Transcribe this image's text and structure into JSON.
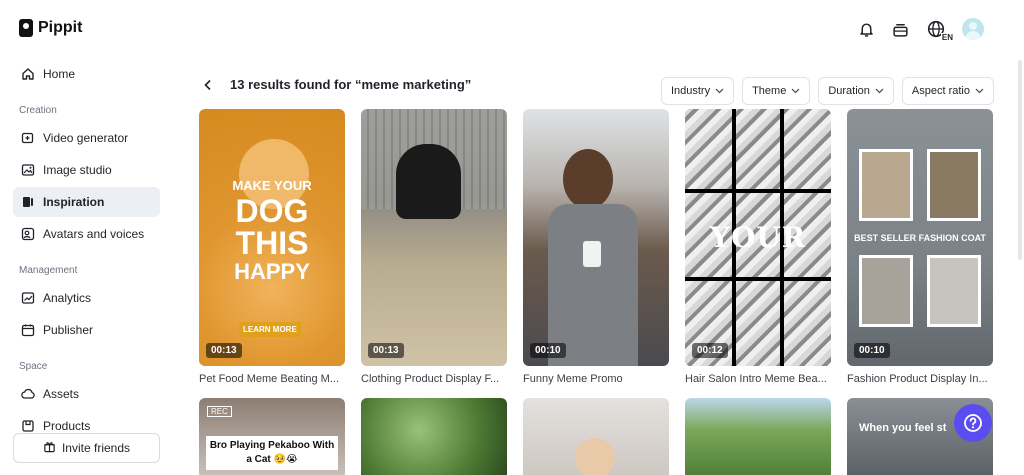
{
  "app": {
    "name": "Pippit"
  },
  "sidebar": {
    "home": "Home",
    "creation_label": "Creation",
    "creation_items": [
      "Video generator",
      "Image studio",
      "Inspiration",
      "Avatars and voices"
    ],
    "management_label": "Management",
    "management_items": [
      "Analytics",
      "Publisher"
    ],
    "space_label": "Space",
    "space_items": [
      "Assets",
      "Products"
    ],
    "invite": "Invite friends"
  },
  "topbar": {
    "language": "EN"
  },
  "results": {
    "back": "‹",
    "title": "13 results found for “meme marketing”"
  },
  "filters": [
    "Industry",
    "Theme",
    "Duration",
    "Aspect ratio"
  ],
  "cards": [
    {
      "title": "Pet Food Meme Beating M...",
      "duration": "00:13",
      "overlay": [
        "MAKE YOUR",
        "DOG",
        "THIS",
        "HAPPY"
      ],
      "cta": "LEARN MORE"
    },
    {
      "title": "Clothing Product Display F...",
      "duration": "00:13"
    },
    {
      "title": "Funny Meme Promo",
      "duration": "00:10"
    },
    {
      "title": "Hair Salon Intro Meme Bea...",
      "duration": "00:12",
      "overlay_text": "YOUR"
    },
    {
      "title": "Fashion Product Display In...",
      "duration": "00:10",
      "overlay_text": "BEST SELLER FASHION COAT"
    }
  ],
  "row2": [
    {
      "overlay_text": "Bro Playing Pekaboo With a Cat 🥹😭",
      "badge": "REC"
    },
    {},
    {},
    {},
    {
      "overlay_text": "When you feel st"
    }
  ],
  "colors": {
    "accent": "#5b4cf0",
    "active_bg": "#eceff3"
  }
}
